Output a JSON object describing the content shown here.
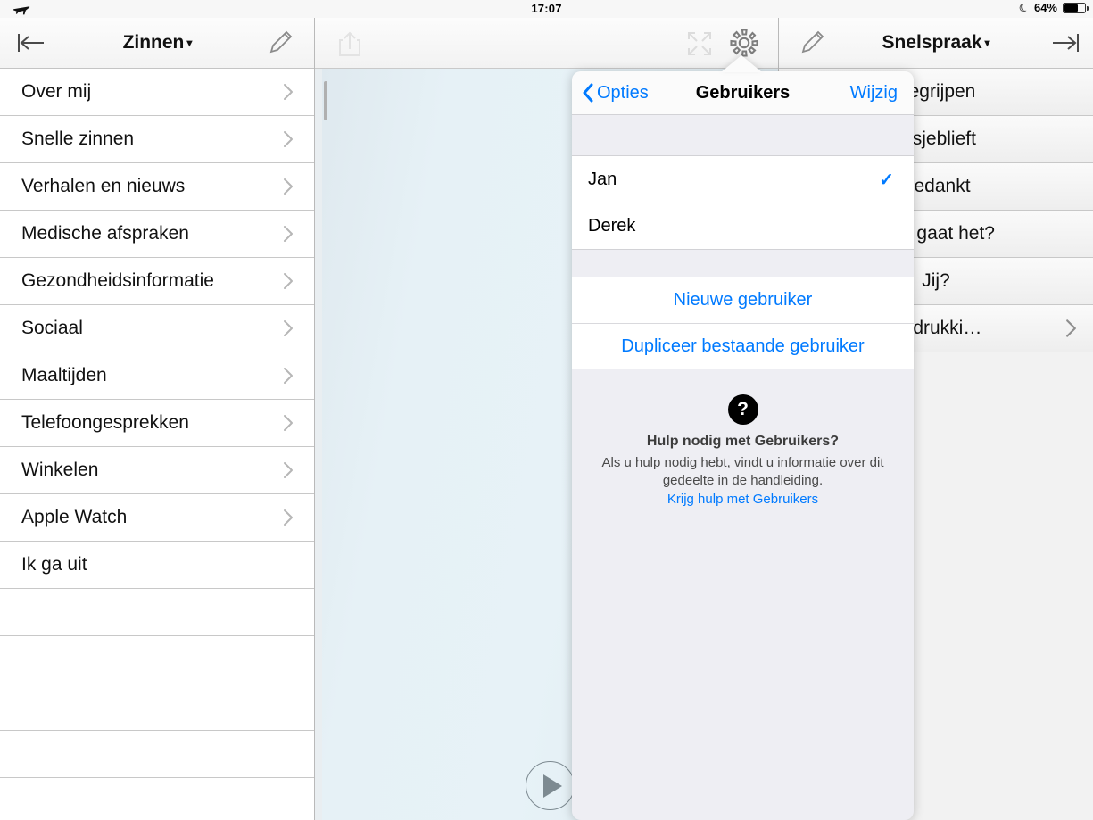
{
  "statusbar": {
    "airplane_icon": "airplane-mode-icon",
    "time": "17:07",
    "dnd_icon": "moon-icon",
    "battery_percent": "64%",
    "battery_level": 64
  },
  "left_panel": {
    "nav": {
      "back_icon": "back-to-bar-icon",
      "title": "Zinnen",
      "caret": "▾",
      "edit_icon": "pencil-icon"
    },
    "items": [
      {
        "label": "Over mij",
        "chevron": true
      },
      {
        "label": "Snelle zinnen",
        "chevron": true
      },
      {
        "label": "Verhalen en nieuws",
        "chevron": true
      },
      {
        "label": "Medische afspraken",
        "chevron": true
      },
      {
        "label": "Gezondheidsinformatie",
        "chevron": true
      },
      {
        "label": "Sociaal",
        "chevron": true
      },
      {
        "label": "Maaltijden",
        "chevron": true
      },
      {
        "label": "Telefoongesprekken",
        "chevron": true
      },
      {
        "label": "Winkelen",
        "chevron": true
      },
      {
        "label": "Apple Watch",
        "chevron": true
      },
      {
        "label": "Ik ga uit",
        "chevron": false
      }
    ],
    "empty_rows": 5
  },
  "middle_panel": {
    "toolbar": {
      "share_icon": "share-icon",
      "expand_icon": "expand-icon",
      "settings_icon": "gear-icon"
    },
    "play_icon": "play-icon",
    "text_value": ""
  },
  "right_panel": {
    "nav": {
      "edit_icon": "pencil-icon",
      "title": "Snelspraak",
      "caret": "▾",
      "forward_icon": "forward-to-bar-icon"
    },
    "items": [
      {
        "label": "Begrijpen",
        "chevron": false
      },
      {
        "label": "Alsjeblieft",
        "chevron": false
      },
      {
        "label": "Bedankt",
        "chevron": false
      },
      {
        "label": "Hoe gaat het?",
        "chevron": false
      },
      {
        "label": "Jij?",
        "chevron": false
      },
      {
        "label": "Uitdrukki…",
        "chevron": true
      }
    ]
  },
  "popover": {
    "nav": {
      "back_label": "Opties",
      "back_icon": "chevron-left-icon",
      "title": "Gebruikers",
      "action_label": "Wijzig"
    },
    "users": [
      {
        "name": "Jan",
        "selected": true,
        "check": "✓"
      },
      {
        "name": "Derek",
        "selected": false,
        "check": ""
      }
    ],
    "actions": [
      {
        "label": "Nieuwe gebruiker"
      },
      {
        "label": "Dupliceer bestaande gebruiker"
      }
    ],
    "help": {
      "badge": "?",
      "title": "Hulp nodig met Gebruikers?",
      "body": "Als u hulp nodig hebt, vindt u informatie over dit gedeelte in de handleiding.",
      "link": "Krijg hulp met Gebruikers"
    }
  },
  "colors": {
    "accent_blue": "#007aff",
    "nav_bg": "#f4f4f4",
    "canvas": "#e4eff4",
    "separator": "#c8c8c8"
  }
}
